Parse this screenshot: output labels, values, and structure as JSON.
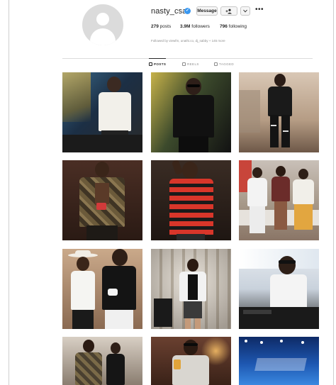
{
  "profile": {
    "username": "nasty_csa",
    "verified_icon": "verified-badge-icon",
    "buttons": {
      "message_label": "Message",
      "follow_icon": "person-add-icon",
      "suggest_icon": "chevron-down-icon",
      "more_icon": "more-horizontal-icon"
    },
    "stats": {
      "posts_count": "279",
      "posts_label": "posts",
      "followers_count": "3.9M",
      "followers_label": "followers",
      "following_count": "796",
      "following_label": "following"
    },
    "followed_by": "Followed by viewfm, unathi.co, dj_sabby + 145 more"
  },
  "tabs": [
    {
      "label": "POSTS",
      "icon": "grid-icon",
      "active": true
    },
    {
      "label": "REELS",
      "icon": "reels-icon",
      "active": false
    },
    {
      "label": "TAGGED",
      "icon": "tagged-icon",
      "active": false
    }
  ],
  "colors": {
    "verified": "#3897f0",
    "text": "#262626",
    "muted": "#8e8e8e",
    "divider": "#dbdbdb"
  },
  "posts": [
    {
      "name": "post-dj-white-shirt"
    },
    {
      "name": "post-black-shirt-sunglasses"
    },
    {
      "name": "post-black-outfit-standing"
    },
    {
      "name": "post-camo-jacket"
    },
    {
      "name": "post-red-striped-shirt"
    },
    {
      "name": "post-group-on-couch"
    },
    {
      "name": "post-white-hat-duo"
    },
    {
      "name": "post-white-jacket-dancing"
    },
    {
      "name": "post-dj-at-console"
    },
    {
      "name": "post-couple-posing"
    },
    {
      "name": "post-holding-drink"
    },
    {
      "name": "post-blue-stage"
    }
  ]
}
